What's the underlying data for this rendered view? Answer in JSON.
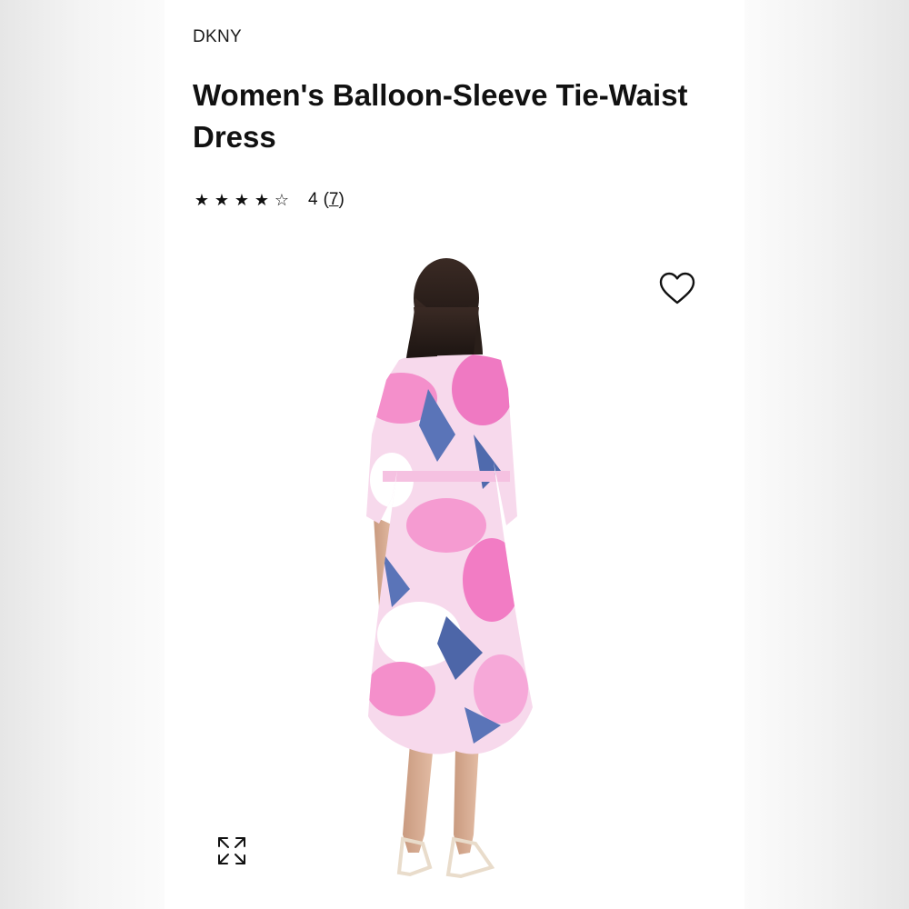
{
  "product": {
    "brand": "DKNY",
    "title": "Women's Balloon-Sleeve Tie-Waist Dress",
    "rating": {
      "stars_filled": 4,
      "stars_total": 5,
      "value": "4",
      "review_count": "7"
    },
    "image": {
      "subject": "model wearing pink and blue floral midi dress, back view",
      "dress_colors": [
        "#f48fcb",
        "#5a74b8",
        "#ffffff"
      ]
    }
  },
  "icons": {
    "favorite": "heart-outline-icon",
    "expand": "expand-arrows-icon",
    "star_filled": "★",
    "star_empty": "☆"
  },
  "colors": {
    "text": "#111111",
    "background": "#ffffff"
  }
}
